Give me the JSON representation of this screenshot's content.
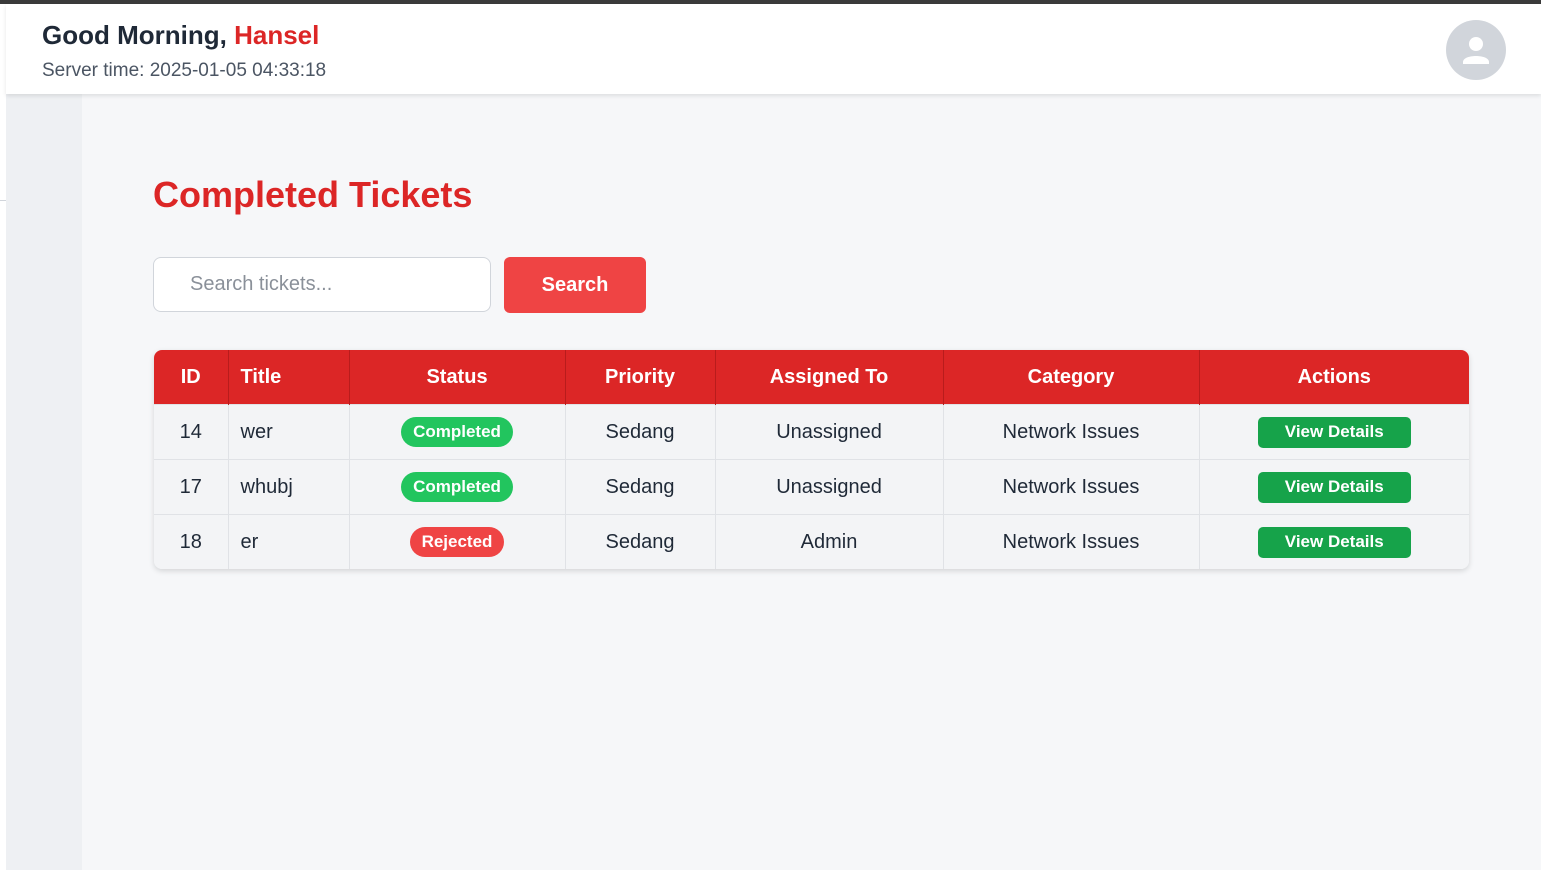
{
  "header": {
    "greeting_prefix": "Good Morning, ",
    "user_name": "Hansel",
    "server_time": "Server time: 2025-01-05 04:33:18",
    "avatar_icon": "user-icon"
  },
  "page": {
    "title": "Completed Tickets"
  },
  "search": {
    "placeholder": "Search tickets...",
    "value": "",
    "button_label": "Search"
  },
  "table": {
    "columns": [
      "ID",
      "Title",
      "Status",
      "Priority",
      "Assigned To",
      "Category",
      "Actions"
    ],
    "rows": [
      {
        "id": "14",
        "title": "wer",
        "status": "Completed",
        "status_color": "#22c55e",
        "priority": "Sedang",
        "assigned_to": "Unassigned",
        "category": "Network Issues",
        "action": "View Details"
      },
      {
        "id": "17",
        "title": "whubj",
        "status": "Completed",
        "status_color": "#22c55e",
        "priority": "Sedang",
        "assigned_to": "Unassigned",
        "category": "Network Issues",
        "action": "View Details"
      },
      {
        "id": "18",
        "title": "er",
        "status": "Rejected",
        "status_color": "#ef4444",
        "priority": "Sedang",
        "assigned_to": "Admin",
        "category": "Network Issues",
        "action": "View Details"
      }
    ]
  },
  "colors": {
    "accent": "#dc2626",
    "search_button": "#ef4444",
    "action_button": "#16a34a"
  }
}
